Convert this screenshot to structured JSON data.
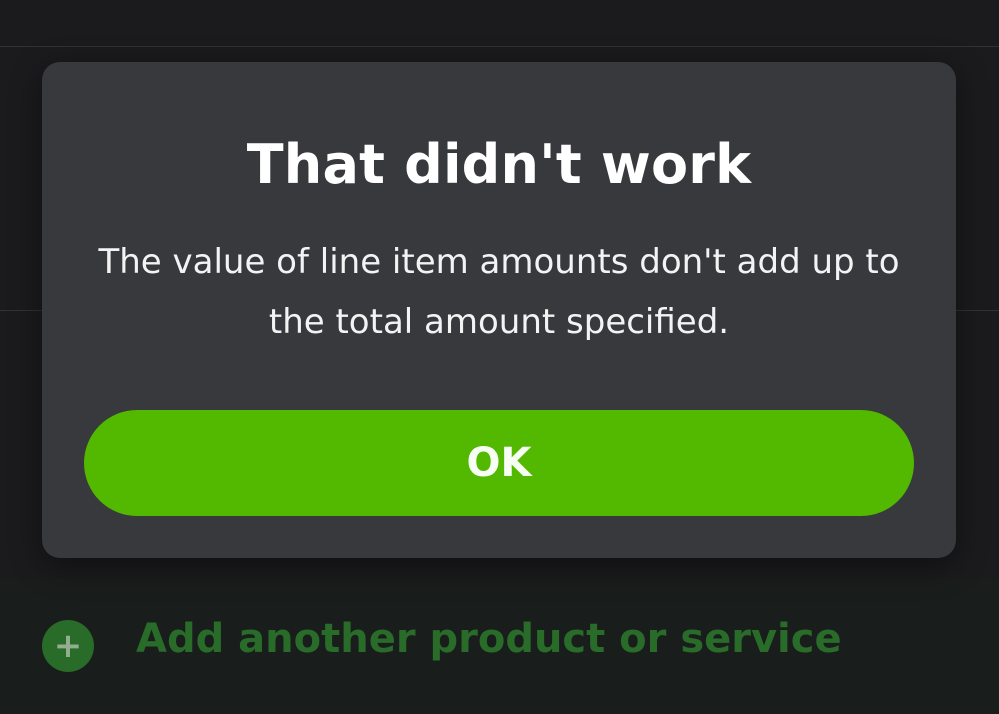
{
  "background": {
    "add_row_label": "Add another product or service",
    "add_row_icon": "plus-icon"
  },
  "dialog": {
    "title": "That didn't work",
    "message": "The value of line item amounts don't add up to the total amount specified.",
    "ok_label": "OK"
  },
  "colors": {
    "dialog_background": "#38393d",
    "ok_button": "#52b800",
    "add_row_accent": "#2f7a2e"
  }
}
